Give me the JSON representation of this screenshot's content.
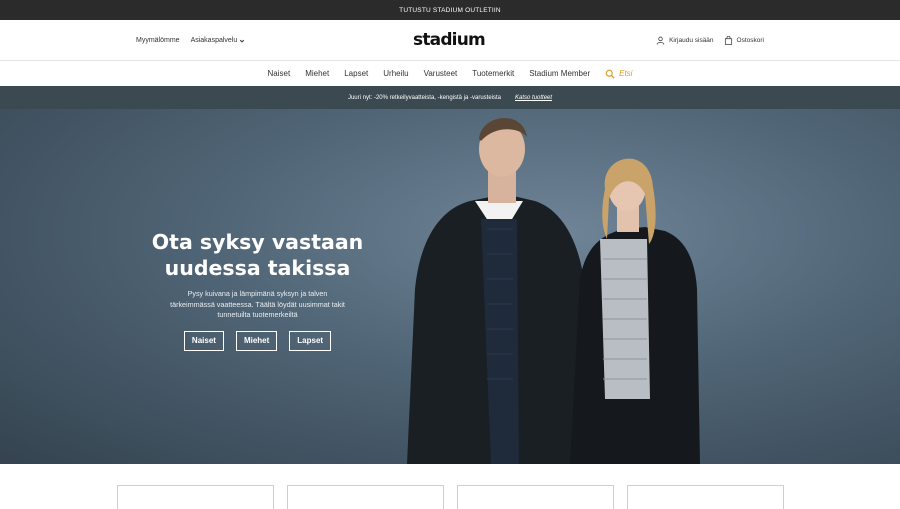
{
  "topbar": {
    "text": "TUTUSTU STADIUM OUTLETIIN"
  },
  "header": {
    "left_links": {
      "stores": "Myymälömme",
      "support": "Asiakaspalvelu"
    },
    "logo": "stadium",
    "login": "Kirjaudu sisään",
    "cart": "Ostoskori"
  },
  "nav": {
    "items": [
      "Naiset",
      "Miehet",
      "Lapset",
      "Urheilu",
      "Varusteet",
      "Tuotemerkit",
      "Stadium Member"
    ],
    "search_label": "Etsi"
  },
  "promo": {
    "text": "Juuri nyt: -20% retkeilyvaatteista, -kengistä ja -varusteista",
    "link": "Katso tuotteet"
  },
  "hero": {
    "title_line1": "Ota syksy vastaan",
    "title_line2": "uudessa takissa",
    "subtitle_line1": "Pysy kuivana ja lämpimänä syksyn ja talven",
    "subtitle_line2": "tärkeimmässä vaatteessa. Täältä löydät uusimmat takit",
    "subtitle_line3": "tunnetuilta tuotemerkeiltä",
    "buttons": [
      "Naiset",
      "Miehet",
      "Lapset"
    ]
  },
  "colors": {
    "topbar": "#2b2b2b",
    "promo": "#3b4950",
    "search_accent": "#d89a20",
    "hero_bg": "#4f6475"
  }
}
